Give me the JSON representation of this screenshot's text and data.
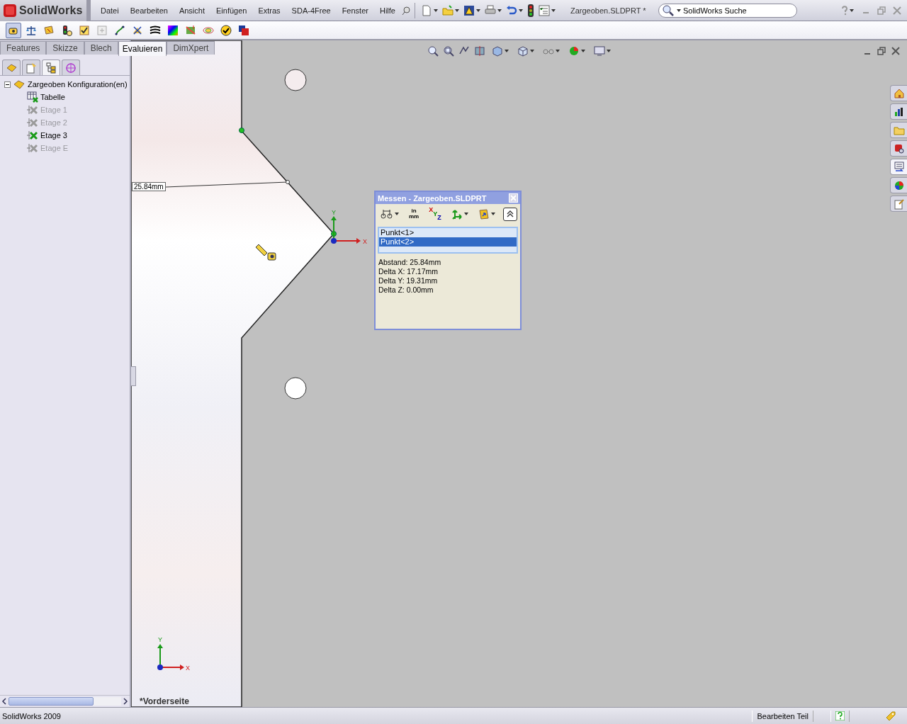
{
  "app": {
    "logo": "SolidWorks",
    "menu": [
      "Datei",
      "Bearbeiten",
      "Ansicht",
      "Einfügen",
      "Extras",
      "SDA-4Free",
      "Fenster",
      "Hilfe"
    ],
    "document_title": "Zargeoben.SLDPRT *",
    "search": {
      "placeholder": "SolidWorks Suche"
    }
  },
  "evaluate_toolbar": [
    {
      "selected": true
    },
    {
      "selected": false
    },
    {
      "selected": false
    },
    {
      "selected": false
    },
    {
      "selected": false
    },
    {
      "selected": false
    },
    {
      "selected": false
    },
    {
      "selected": false
    },
    {
      "selected": false
    },
    {
      "selected": false
    },
    {
      "selected": false
    },
    {
      "selected": false
    },
    {
      "selected": false
    },
    {
      "selected": false
    }
  ],
  "command_tabs": [
    {
      "label": "Features",
      "selected": false
    },
    {
      "label": "Skizze",
      "selected": false
    },
    {
      "label": "Blech",
      "selected": false
    },
    {
      "label": "Evaluieren",
      "selected": true
    },
    {
      "label": "DimXpert",
      "selected": false
    }
  ],
  "panel_tabs": [
    {
      "selected": false
    },
    {
      "selected": false
    },
    {
      "selected": true
    },
    {
      "selected": false
    }
  ],
  "feature_tree": {
    "label": "Zargeoben Konfiguration(en)",
    "expanded": true,
    "children": [
      {
        "label": "Tabelle",
        "kind": "table",
        "active": true
      },
      {
        "label": "Etage 1",
        "kind": "config",
        "active": false
      },
      {
        "label": "Etage 2",
        "kind": "config",
        "active": false
      },
      {
        "label": "Etage 3",
        "kind": "config",
        "active": true
      },
      {
        "label": "Etage E",
        "kind": "config",
        "active": false
      }
    ]
  },
  "viewport": {
    "dimension": "25.84mm",
    "view_name": "*Vorderseite",
    "origin_triad": {
      "x": "X",
      "y": "Y"
    },
    "view_triad": {
      "x": "X",
      "y": "Y"
    }
  },
  "task_pane": [
    {
      "selected": false
    },
    {
      "selected": false
    },
    {
      "selected": false
    },
    {
      "selected": false
    },
    {
      "selected": true
    },
    {
      "selected": false
    },
    {
      "selected": false
    }
  ],
  "measure": {
    "title": "Messen - Zargeoben.SLDPRT",
    "toolbar": [
      {
        "kind": "arc",
        "dropdown": true
      },
      {
        "kind": "units",
        "top": "in",
        "bottom": "mm",
        "dropdown": false
      },
      {
        "kind": "xyz",
        "letters": [
          "X",
          "Y",
          "Z"
        ],
        "dropdown": false
      },
      {
        "kind": "axes",
        "dropdown": true
      },
      {
        "kind": "folder",
        "dropdown": true
      }
    ],
    "selections": [
      {
        "label": "Punkt<1>",
        "selected": false
      },
      {
        "label": "Punkt<2>",
        "selected": true
      }
    ],
    "results": [
      "Abstand: 25.84mm",
      "Delta X: 17.17mm",
      "Delta Y: 19.31mm",
      "Delta Z: 0.00mm"
    ]
  },
  "status_bar": {
    "version": "SolidWorks 2009",
    "mode": "Bearbeiten Teil"
  }
}
